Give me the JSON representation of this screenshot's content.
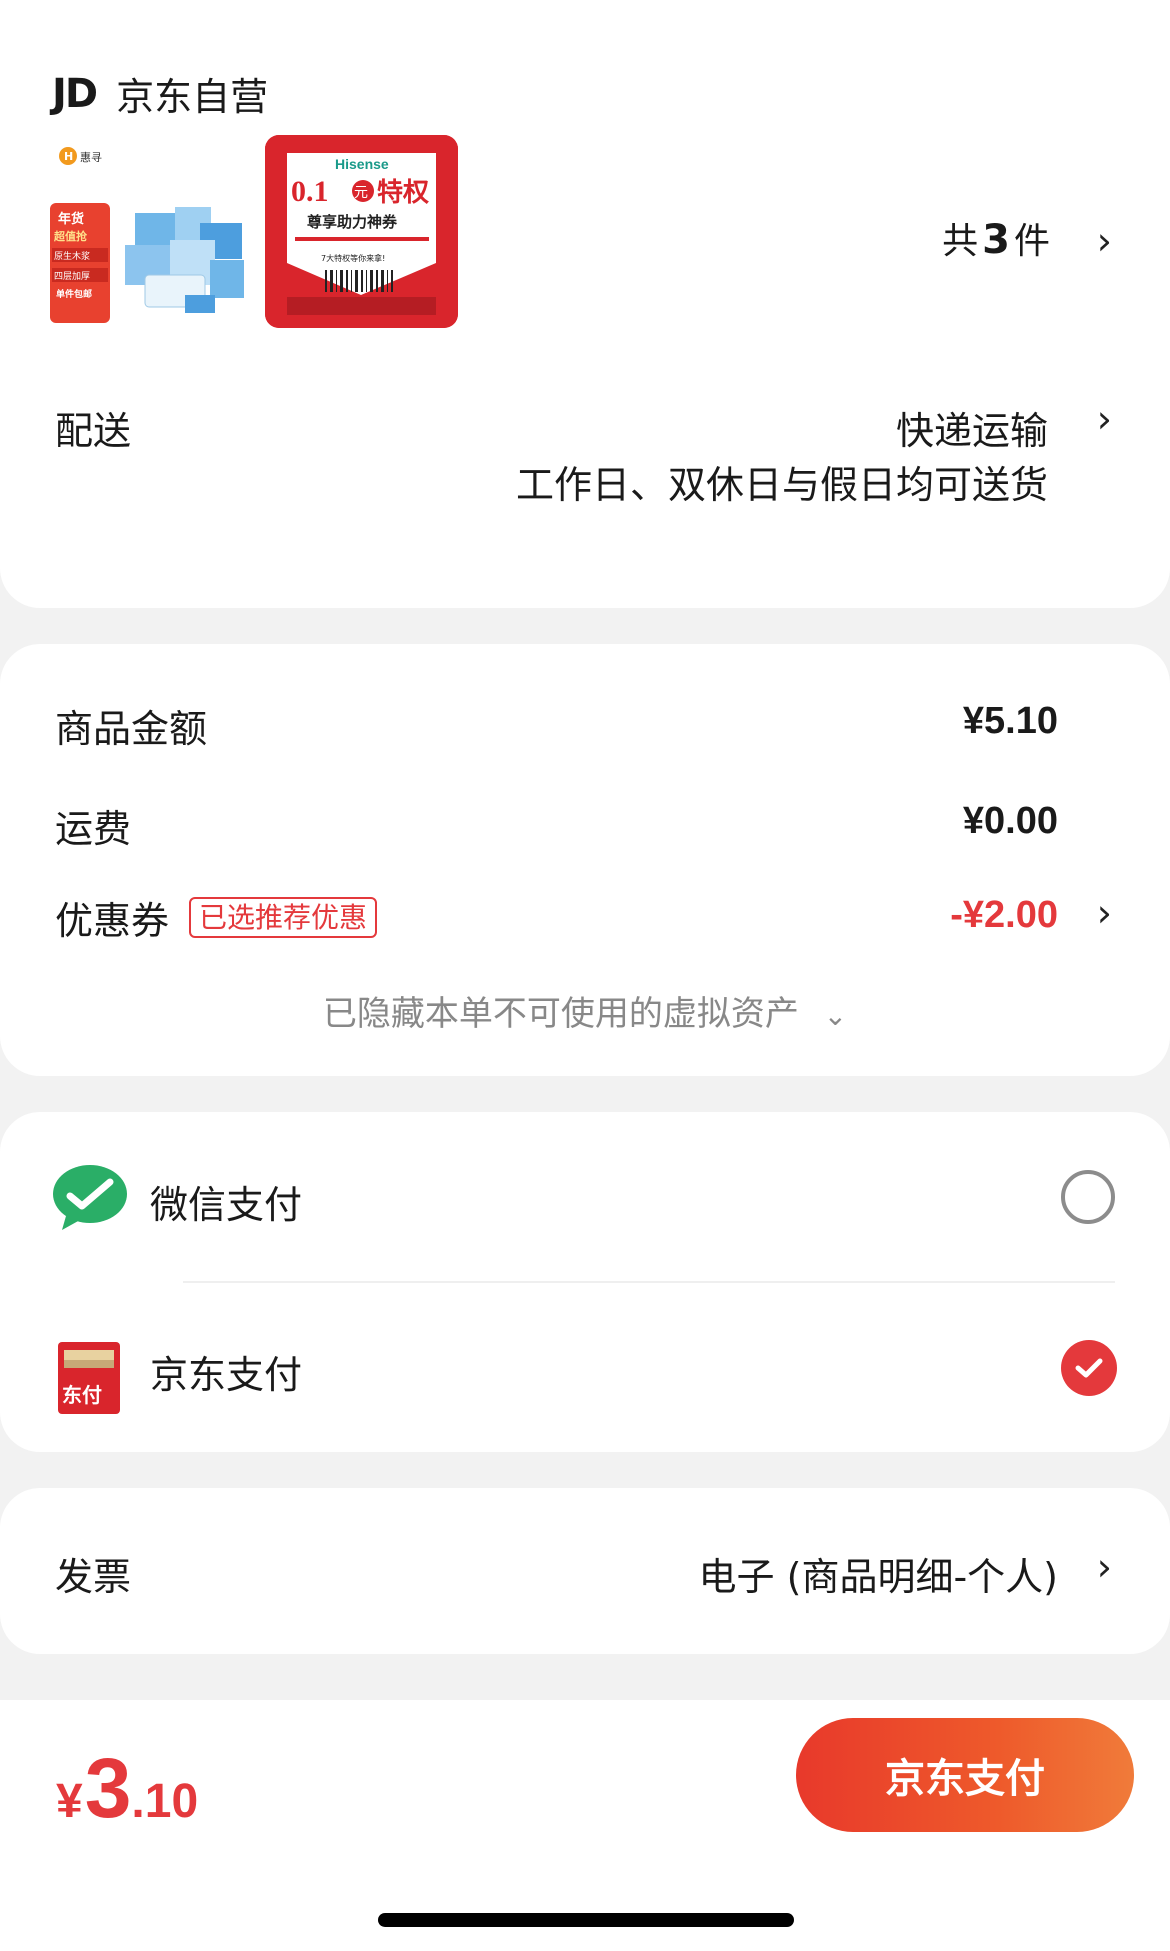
{
  "shop": {
    "logo_text": "JD",
    "name": "京东自营",
    "thumb1": {
      "brand": "惠寻",
      "tags": [
        "年货",
        "超值抢",
        "原生木浆",
        "四层加厚",
        "单件包邮"
      ]
    },
    "thumb2": {
      "brand": "Hisense",
      "price": "0.1",
      "yuan": "元",
      "title": "特权",
      "subtitle": "尊享助力神券",
      "note": "7大特权等你来拿!"
    },
    "qty_prefix": "共",
    "qty_num": "3",
    "qty_suffix": "件"
  },
  "delivery": {
    "label": "配送",
    "method": "快递运输",
    "note": "工作日、双休日与假日均可送货"
  },
  "amounts": {
    "goods_label": "商品金额",
    "goods_value": "¥5.10",
    "shipping_label": "运费",
    "shipping_value": "¥0.00",
    "coupon_label": "优惠券",
    "coupon_tag": "已选推荐优惠",
    "coupon_value": "-¥2.00",
    "hidden_note": "已隐藏本单不可使用的虚拟资产",
    "hidden_chevron": "⌄"
  },
  "payment": {
    "wechat_label": "微信支付",
    "jd_label": "京东支付",
    "jd_icon_text": "东付",
    "selected": "jd"
  },
  "invoice": {
    "label": "发票",
    "value": "电子 (商品明细-个人)"
  },
  "footer": {
    "total_symbol": "¥",
    "total_int": "3",
    "total_dec": ".10",
    "pay_button": "京东支付"
  },
  "colors": {
    "accent": "#e4393c",
    "wechat_green": "#2aae67"
  }
}
